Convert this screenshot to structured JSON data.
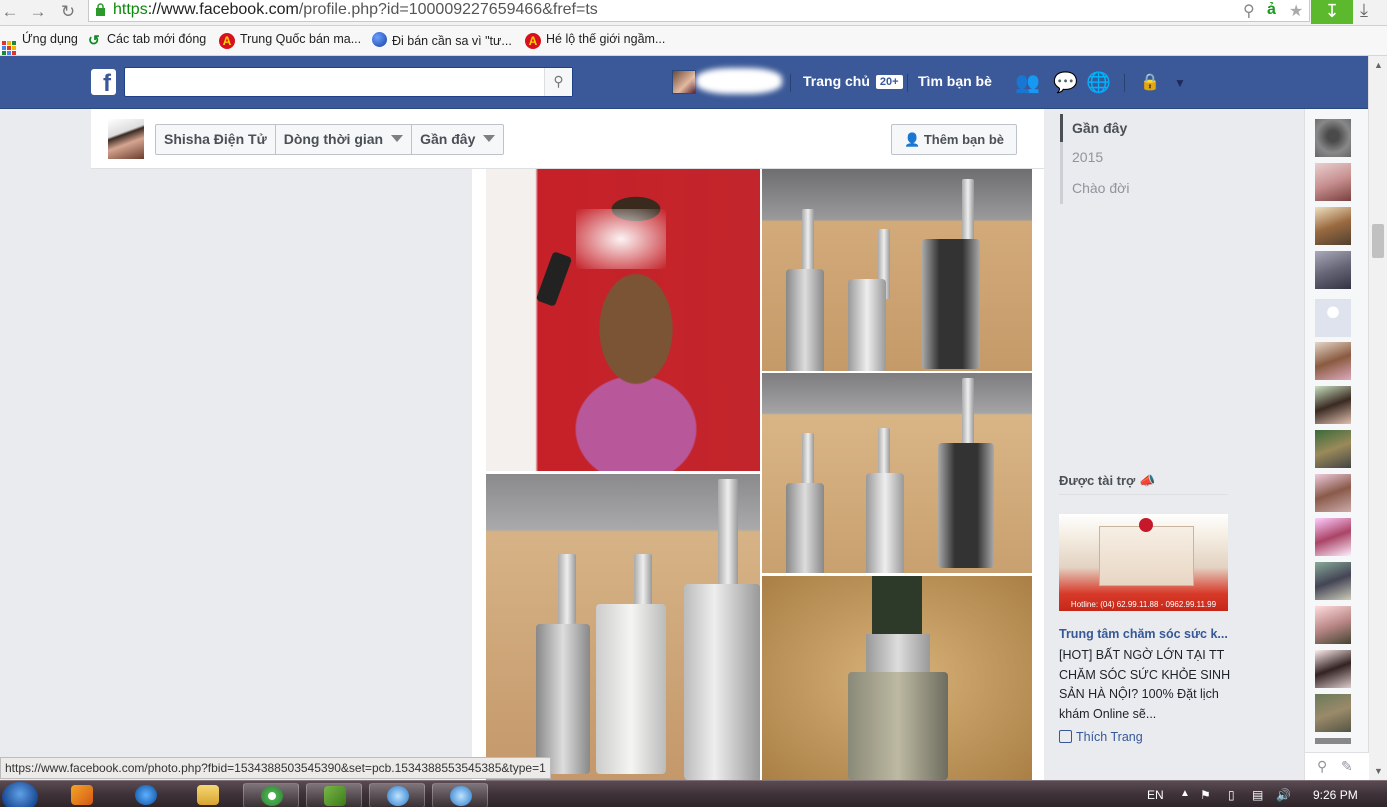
{
  "browser": {
    "url_scheme": "https",
    "url_host": "://www.facebook.com",
    "url_path": "/profile.php?id=100009227659466&fref=ts",
    "status_url": "https://www.facebook.com/photo.php?fbid=1534388503545390&set=pcb.1534388553545385&type=1",
    "bookmarks": [
      {
        "label": "Ứng dụng"
      },
      {
        "label": "Các tab mới đóng"
      },
      {
        "label": "Trung Quốc bán ma..."
      },
      {
        "label": "Đi bán cần sa vì \"tư..."
      },
      {
        "label": "Hé lộ thế giới ngầm..."
      }
    ]
  },
  "fb_header": {
    "logo_letter": "f",
    "search_placeholder": "",
    "home_label": "Trang chủ",
    "home_badge": "20+",
    "find_friends_label": "Tìm bạn bè"
  },
  "timeline_nav": {
    "profile_name": "Shisha Điện Tử",
    "tab_timeline": "Dòng thời gian",
    "tab_recent": "Gần đây",
    "add_friend_label": "Thêm bạn bè"
  },
  "year_nav": {
    "items": [
      "Gần đây",
      "2015",
      "Chào đời"
    ]
  },
  "sponsored": {
    "heading": "Được tài trợ",
    "ad_hotline": "Hotline: (04) 62.99.11.88 - 0962.99.11.99",
    "ad_title": "Trung tâm chăm sóc sức k...",
    "ad_body": "[HOT] BẤT NGỜ LỚN TẠI TT CHĂM SÓC SỨC KHỎE SINH SẢN HÀ NỘI? 100% Đặt lịch khám Online sẽ...",
    "like_label": "Thích Trang"
  },
  "taskbar": {
    "lang": "EN",
    "time": "9:26 PM"
  },
  "colors": {
    "fb_blue": "#3b5998",
    "link_blue": "#365899",
    "page_bg": "#e9ebee"
  }
}
